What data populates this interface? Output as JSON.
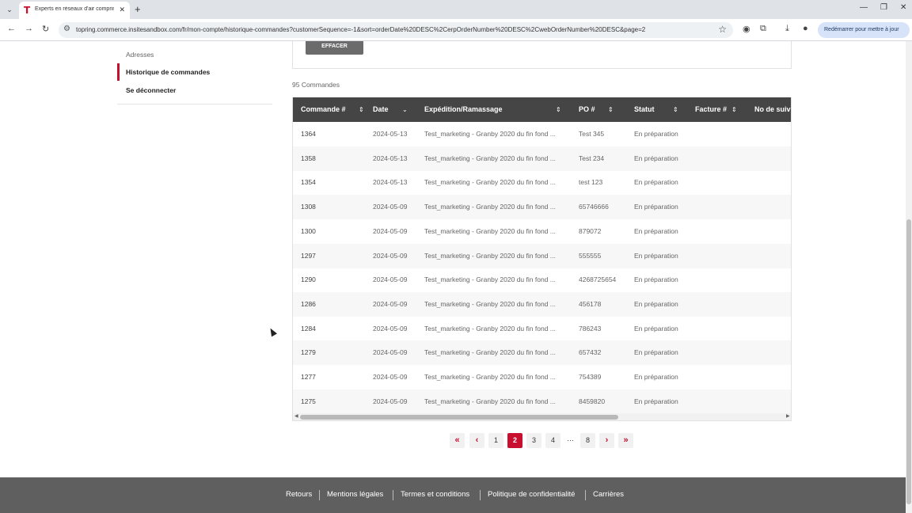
{
  "browser": {
    "tab_title": "Experts en réseaux d'air comprimé",
    "url": "topring.commerce.insitesandbox.com/fr/mon-compte/historique-commandes?customerSequence=-1&sort=orderDate%20DESC%2CerpOrderNumber%20DESC%2CwebOrderNumber%20DESC&page=2",
    "restart_label": "Redémarrer pour mettre à jour"
  },
  "sidebar": {
    "items": [
      {
        "label": "Adresses"
      },
      {
        "label": "Historique de commandes"
      },
      {
        "label": "Se déconnecter"
      }
    ]
  },
  "filters": {
    "clear_label": "EFFACER"
  },
  "orders": {
    "count_label": "95 Commandes",
    "columns": [
      "Commande #",
      "Date",
      "Expédition/Ramassage",
      "PO #",
      "Statut",
      "Facture #",
      "No de suivi"
    ],
    "rows": [
      {
        "order": "1364",
        "date": "2024-05-13",
        "shipping": "Test_marketing - Granby 2020 du fin fond ...",
        "po": "Test 345",
        "status": "En préparation"
      },
      {
        "order": "1358",
        "date": "2024-05-13",
        "shipping": "Test_marketing - Granby 2020 du fin fond ...",
        "po": "Test 234",
        "status": "En préparation"
      },
      {
        "order": "1354",
        "date": "2024-05-13",
        "shipping": "Test_marketing - Granby 2020 du fin fond ...",
        "po": "test 123",
        "status": "En préparation"
      },
      {
        "order": "1308",
        "date": "2024-05-09",
        "shipping": "Test_marketing - Granby 2020 du fin fond ...",
        "po": "65746666",
        "status": "En préparation"
      },
      {
        "order": "1300",
        "date": "2024-05-09",
        "shipping": "Test_marketing - Granby 2020 du fin fond ...",
        "po": "879072",
        "status": "En préparation"
      },
      {
        "order": "1297",
        "date": "2024-05-09",
        "shipping": "Test_marketing - Granby 2020 du fin fond ...",
        "po": "555555",
        "status": "En préparation"
      },
      {
        "order": "1290",
        "date": "2024-05-09",
        "shipping": "Test_marketing - Granby 2020 du fin fond ...",
        "po": "4268725654",
        "status": "En préparation"
      },
      {
        "order": "1286",
        "date": "2024-05-09",
        "shipping": "Test_marketing - Granby 2020 du fin fond ...",
        "po": "456178",
        "status": "En préparation"
      },
      {
        "order": "1284",
        "date": "2024-05-09",
        "shipping": "Test_marketing - Granby 2020 du fin fond ...",
        "po": "786243",
        "status": "En préparation"
      },
      {
        "order": "1279",
        "date": "2024-05-09",
        "shipping": "Test_marketing - Granby 2020 du fin fond ...",
        "po": "657432",
        "status": "En préparation"
      },
      {
        "order": "1277",
        "date": "2024-05-09",
        "shipping": "Test_marketing - Granby 2020 du fin fond ...",
        "po": "754389",
        "status": "En préparation"
      },
      {
        "order": "1275",
        "date": "2024-05-09",
        "shipping": "Test_marketing - Granby 2020 du fin fond ...",
        "po": "8459820",
        "status": "En préparation"
      }
    ]
  },
  "pagination": {
    "first": "«",
    "prev": "‹",
    "pages": [
      "1",
      "2",
      "3",
      "4"
    ],
    "ellipsis": "···",
    "last_page": "8",
    "next": "›",
    "last": "»",
    "current": "2"
  },
  "footer": {
    "links": [
      "Retours",
      "Mentions légales",
      "Termes et conditions",
      "Politique de confidentialité",
      "Carrières"
    ]
  },
  "colors": {
    "accent": "#c8102e",
    "header_bg": "#454545",
    "footer_bg": "#5f5f5f"
  }
}
